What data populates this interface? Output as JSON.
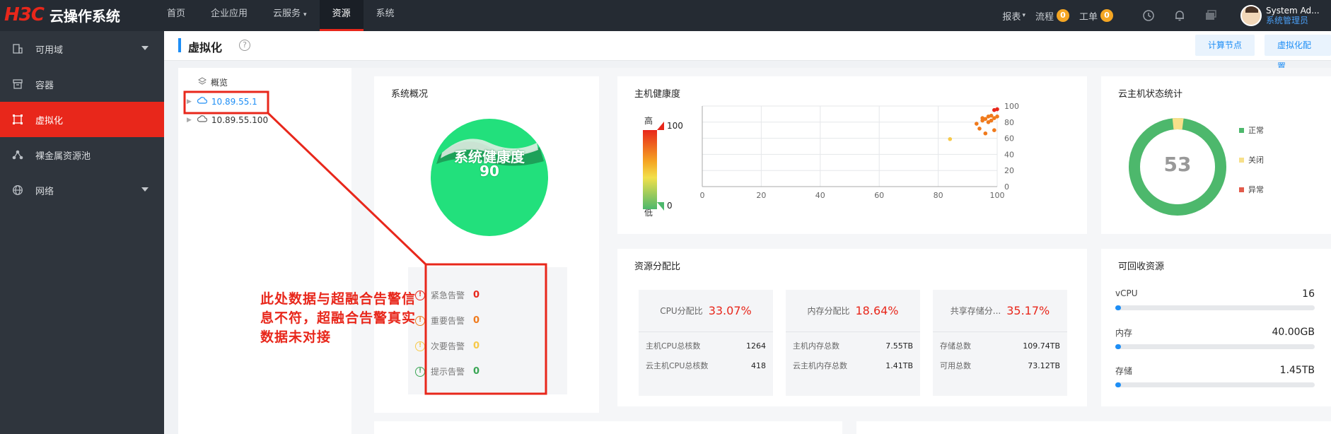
{
  "app": {
    "logo": "H3C",
    "name": "云操作系统"
  },
  "topnav": [
    {
      "label": "首页"
    },
    {
      "label": "企业应用"
    },
    {
      "label": "云服务",
      "caret": "▾"
    },
    {
      "label": "资源",
      "active": true
    },
    {
      "label": "系统"
    }
  ],
  "topright": {
    "report": "报表",
    "flow": "流程",
    "flow_count": "0",
    "ticket": "工单",
    "ticket_count": "0",
    "user_name": "System Ad...",
    "user_role": "系统管理员"
  },
  "sidebar": [
    {
      "label": "可用域",
      "icon": "zone-icon",
      "expand": true
    },
    {
      "label": "容器",
      "icon": "container-icon"
    },
    {
      "label": "虚拟化",
      "icon": "virtualization-icon",
      "active": true
    },
    {
      "label": "裸金属资源池",
      "icon": "baremetal-icon"
    },
    {
      "label": "网络",
      "icon": "network-icon",
      "expand": true
    }
  ],
  "page": {
    "title": "虚拟化",
    "btn_compute": "计算节点",
    "btn_config": "虚拟化配置"
  },
  "tree": {
    "root": "概览",
    "nodes": [
      "10.89.55.1",
      "10.89.55.100"
    ]
  },
  "overview": {
    "title": "系统概况",
    "health_label": "系统健康度",
    "health_value": "90",
    "alarms": [
      {
        "label": "紧急告警",
        "value": "0",
        "color": "#e8271b"
      },
      {
        "label": "重要告警",
        "value": "0",
        "color": "#f07a1c"
      },
      {
        "label": "次要告警",
        "value": "0",
        "color": "#f7c948"
      },
      {
        "label": "提示告警",
        "value": "0",
        "color": "#3aa655"
      }
    ]
  },
  "host_health": {
    "title": "主机健康度",
    "scale_high": "高",
    "scale_low": "低",
    "scale_max": "100",
    "scale_min": "0"
  },
  "chart_data": {
    "type": "scatter",
    "title": "主机健康度",
    "xlim": [
      0,
      100
    ],
    "ylim": [
      0,
      100
    ],
    "x_ticks": [
      "0",
      "20",
      "40",
      "60",
      "80",
      "100"
    ],
    "y_ticks": [
      "100",
      "80",
      "60",
      "40",
      "20",
      "0"
    ],
    "grid": true,
    "points": [
      [
        84,
        59
      ],
      [
        93,
        78
      ],
      [
        94,
        72
      ],
      [
        95,
        85
      ],
      [
        96,
        84
      ],
      [
        96,
        66
      ],
      [
        97,
        80
      ],
      [
        97,
        87
      ],
      [
        98,
        82
      ],
      [
        98,
        88
      ],
      [
        99,
        85
      ],
      [
        99,
        95
      ],
      [
        100,
        96
      ],
      [
        100,
        87
      ],
      [
        99,
        70
      ],
      [
        95,
        82
      ]
    ]
  },
  "vm_status": {
    "title": "云主机状态统计",
    "total": "53",
    "legend": [
      {
        "label": "正常",
        "color": "#4db86c"
      },
      {
        "label": "关闭",
        "color": "#f7e08a"
      },
      {
        "label": "异常",
        "color": "#e25b4b"
      }
    ],
    "normal": 51,
    "off": 2,
    "error": 0
  },
  "alloc": {
    "title": "资源分配比",
    "items": [
      {
        "label": "CPU分配比",
        "pct": "33.07%",
        "rows": [
          [
            "主机CPU总核数",
            "1264"
          ],
          [
            "云主机CPU总核数",
            "418"
          ]
        ]
      },
      {
        "label": "内存分配比",
        "pct": "18.64%",
        "rows": [
          [
            "主机内存总数",
            "7.55TB"
          ],
          [
            "云主机内存总数",
            "1.41TB"
          ]
        ]
      },
      {
        "label": "共享存储分...",
        "pct": "35.17%",
        "rows": [
          [
            "存储总数",
            "109.74TB"
          ],
          [
            "可用总数",
            "73.12TB"
          ]
        ]
      }
    ]
  },
  "reclaim": {
    "title": "可回收资源",
    "items": [
      {
        "label": "vCPU",
        "value": "16",
        "fraction": 0.03
      },
      {
        "label": "内存",
        "value": "40.00GB",
        "fraction": 0.02
      },
      {
        "label": "存储",
        "value": "1.45TB",
        "fraction": 0.03
      }
    ]
  },
  "annotation": "此处数据与超融合告警信息不符，超融合告警真实数据未对接"
}
